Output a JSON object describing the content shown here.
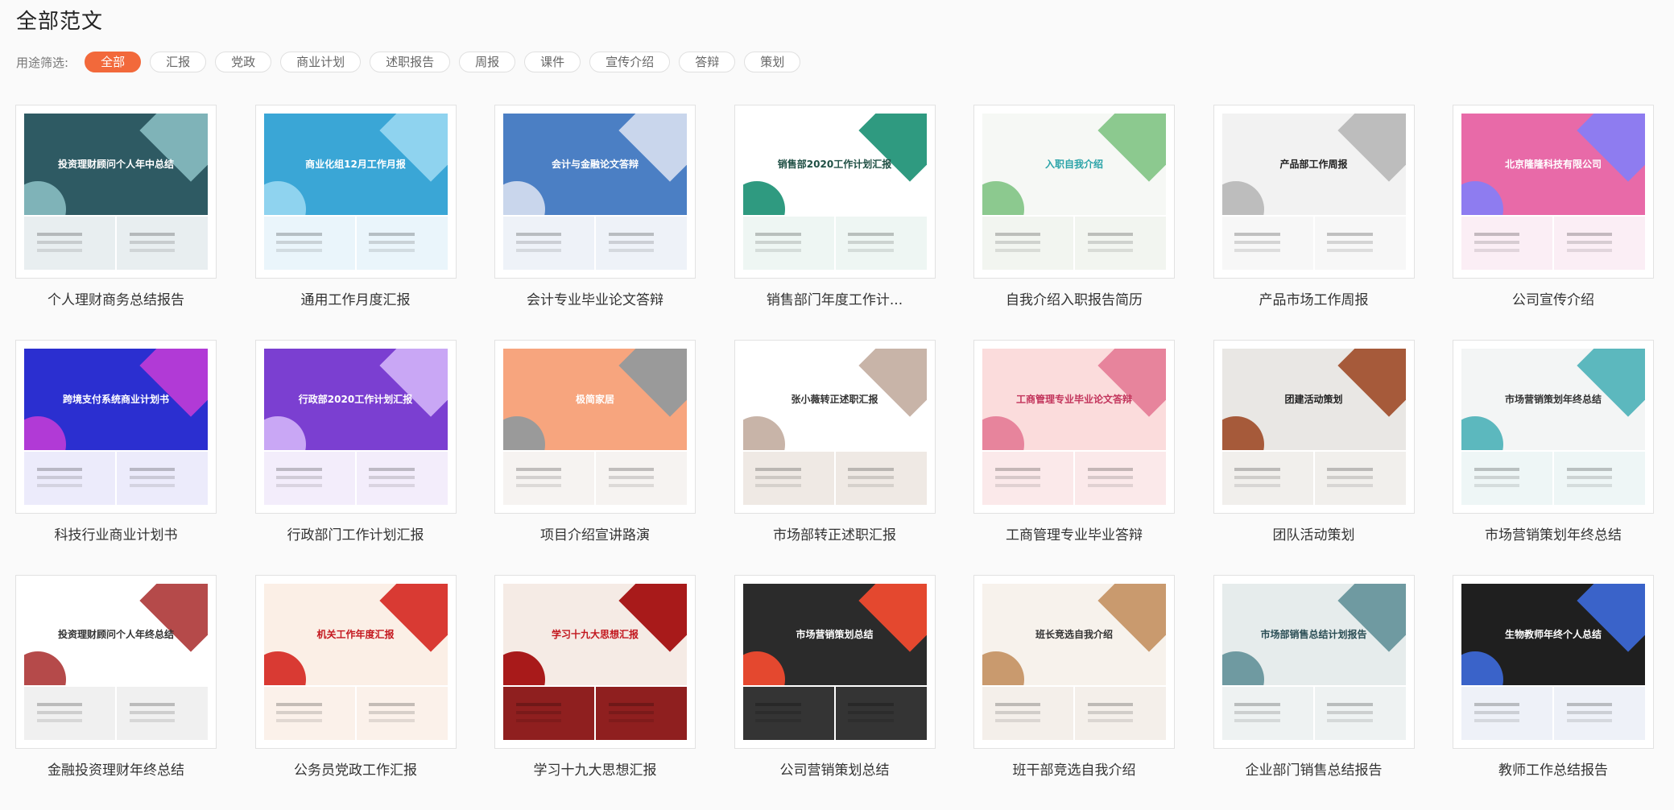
{
  "page": {
    "title": "全部范文"
  },
  "filter": {
    "label": "用途筛选:",
    "chips": [
      {
        "label": "全部",
        "active": true
      },
      {
        "label": "汇报",
        "active": false
      },
      {
        "label": "党政",
        "active": false
      },
      {
        "label": "商业计划",
        "active": false
      },
      {
        "label": "述职报告",
        "active": false
      },
      {
        "label": "周报",
        "active": false
      },
      {
        "label": "课件",
        "active": false
      },
      {
        "label": "宣传介绍",
        "active": false
      },
      {
        "label": "答辩",
        "active": false
      },
      {
        "label": "策划",
        "active": false
      }
    ]
  },
  "templates": [
    {
      "title": "个人理财商务总结报告",
      "preview_title": "投资理财顾问个人年中总结",
      "theme": {
        "bg": "#2e5a63",
        "fg": "#ffffff",
        "accent": "#7fb3b8",
        "sub": "#e8eef0"
      }
    },
    {
      "title": "通用工作月度汇报",
      "preview_title": "商业化组12月工作月报",
      "theme": {
        "bg": "#3aa6d6",
        "fg": "#ffffff",
        "accent": "#8fd3ef",
        "sub": "#eaf5fb"
      }
    },
    {
      "title": "会计专业毕业论文答辩",
      "preview_title": "会计与金融论文答辩",
      "theme": {
        "bg": "#4b7fc4",
        "fg": "#ffffff",
        "accent": "#c9d6ec",
        "sub": "#eef2f8"
      }
    },
    {
      "title": "销售部门年度工作计...",
      "preview_title": "销售部2020工作计划汇报",
      "theme": {
        "bg": "#ffffff",
        "fg": "#1f4f44",
        "accent": "#2f9a80",
        "sub": "#eef6f3"
      }
    },
    {
      "title": "自我介绍入职报告简历",
      "preview_title": "入职自我介绍",
      "theme": {
        "bg": "#f6f8f5",
        "fg": "#2aa3a8",
        "accent": "#8cc98f",
        "sub": "#f2f5f0"
      }
    },
    {
      "title": "产品市场工作周报",
      "preview_title": "产品部工作周报",
      "theme": {
        "bg": "#f2f2f2",
        "fg": "#222222",
        "accent": "#bdbdbd",
        "sub": "#f7f7f7"
      }
    },
    {
      "title": "公司宣传介绍",
      "preview_title": "北京隆隆科技有限公司",
      "theme": {
        "bg": "#e86aa8",
        "fg": "#ffffff",
        "accent": "#8e7cf0",
        "sub": "#fbeef5"
      }
    },
    {
      "title": "科技行业商业计划书",
      "preview_title": "跨境支付系统商业计划书",
      "theme": {
        "bg": "#2b2fd0",
        "fg": "#ffffff",
        "accent": "#b13ad6",
        "sub": "#ecebfb"
      }
    },
    {
      "title": "行政部门工作计划汇报",
      "preview_title": "行政部2020工作计划汇报",
      "theme": {
        "bg": "#7b3fd1",
        "fg": "#ffffff",
        "accent": "#c9a7f5",
        "sub": "#f3edfb"
      }
    },
    {
      "title": "项目介绍宣讲路演",
      "preview_title": "极简家居",
      "theme": {
        "bg": "#f7a57e",
        "fg": "#ffffff",
        "accent": "#9a9a9a",
        "sub": "#f6f3f1"
      }
    },
    {
      "title": "市场部转正述职汇报",
      "preview_title": "张小薇转正述职汇报",
      "theme": {
        "bg": "#ffffff",
        "fg": "#333333",
        "accent": "#c8b4a8",
        "sub": "#efe9e4"
      }
    },
    {
      "title": "工商管理专业毕业答辩",
      "preview_title": "工商管理专业毕业论文答辩",
      "theme": {
        "bg": "#fbdcdc",
        "fg": "#c2335b",
        "accent": "#e7849c",
        "sub": "#fbe9ea"
      }
    },
    {
      "title": "团队活动策划",
      "preview_title": "团建活动策划",
      "theme": {
        "bg": "#e9e7e4",
        "fg": "#222222",
        "accent": "#a65a3a",
        "sub": "#f1efec"
      }
    },
    {
      "title": "市场营销策划年终总结",
      "preview_title": "市场营销策划年终总结",
      "theme": {
        "bg": "#f3f5f5",
        "fg": "#333333",
        "accent": "#5cb8be",
        "sub": "#eef6f6"
      }
    },
    {
      "title": "金融投资理财年终总结",
      "preview_title": "投资理财顾问个人年终总结",
      "theme": {
        "bg": "#ffffff",
        "fg": "#333333",
        "accent": "#b54a4a",
        "sub": "#f0f0f0"
      }
    },
    {
      "title": "公务员党政工作汇报",
      "preview_title": "机关工作年度汇报",
      "theme": {
        "bg": "#fbefe6",
        "fg": "#c4171e",
        "accent": "#d93a33",
        "sub": "#fbf1ea"
      }
    },
    {
      "title": "学习十九大思想汇报",
      "preview_title": "学习十九大思想汇报",
      "theme": {
        "bg": "#f5ebe5",
        "fg": "#c2161d",
        "accent": "#a81a1a",
        "sub": "#8f1f1f"
      }
    },
    {
      "title": "公司营销策划总结",
      "preview_title": "市场营销策划总结",
      "theme": {
        "bg": "#2b2b2b",
        "fg": "#ffffff",
        "accent": "#e4482f",
        "sub": "#343434"
      }
    },
    {
      "title": "班干部竞选自我介绍",
      "preview_title": "班长竞选自我介绍",
      "theme": {
        "bg": "#f7f2ec",
        "fg": "#333333",
        "accent": "#c99a6e",
        "sub": "#f4efea"
      }
    },
    {
      "title": "企业部门销售总结报告",
      "preview_title": "市场部销售总结计划报告",
      "theme": {
        "bg": "#e6ecec",
        "fg": "#2a4d54",
        "accent": "#6f9aa1",
        "sub": "#eef2f2"
      }
    },
    {
      "title": "教师工作总结报告",
      "preview_title": "生物教师年终个人总结",
      "theme": {
        "bg": "#1f1f1f",
        "fg": "#ffffff",
        "accent": "#3a63c9",
        "sub": "#eef1f8"
      }
    }
  ]
}
